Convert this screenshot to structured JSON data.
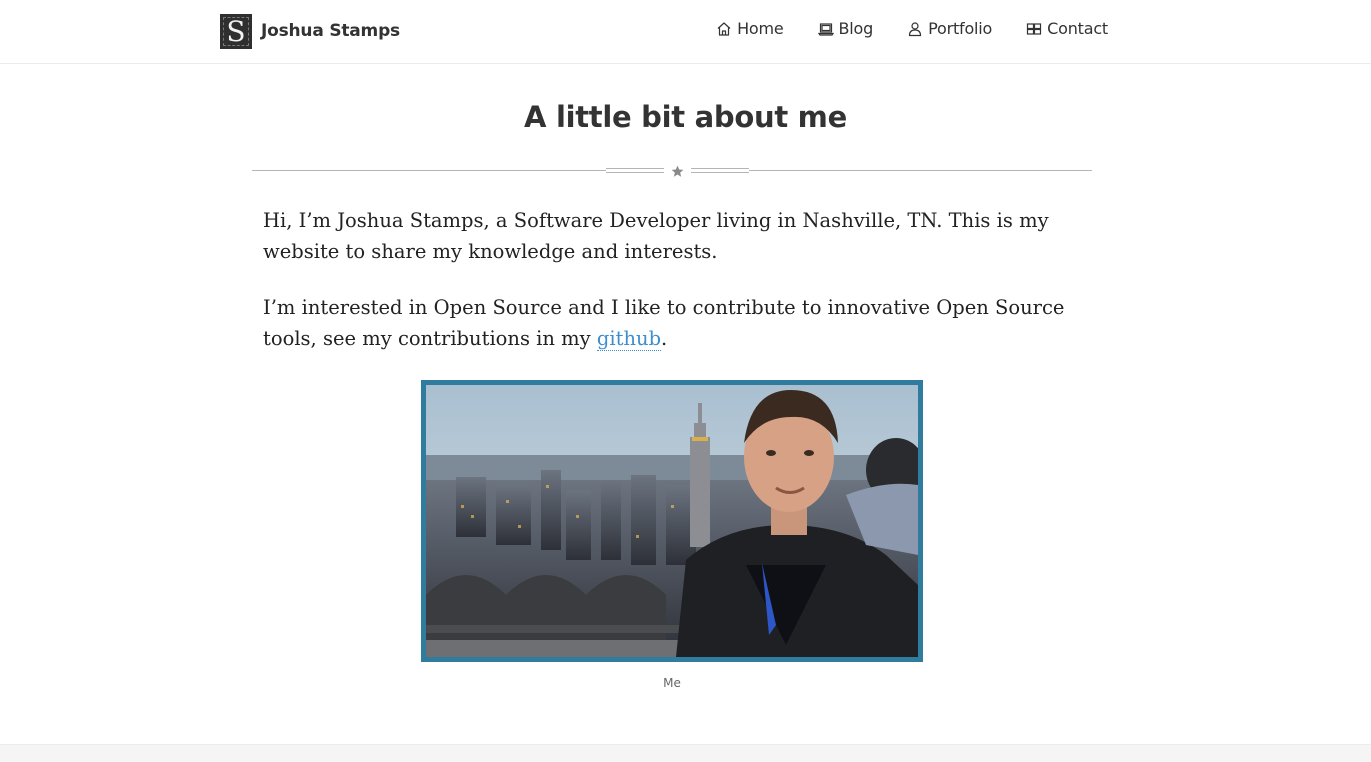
{
  "site": {
    "logo_letter": "S",
    "name": "Joshua Stamps"
  },
  "nav": {
    "home": "Home",
    "blog": "Blog",
    "portfolio": "Portfolio",
    "contact": "Contact"
  },
  "page": {
    "title": "A little bit about me",
    "paragraph1": "Hi, I’m Joshua Stamps, a Software Developer living in Nashville, TN. This is my website to share my knowledge and interests.",
    "paragraph2_before_link": "I’m interested in Open Source and I like to contribute to innovative Open Source tools, see my contributions in my ",
    "paragraph2_link": "github",
    "paragraph2_after_link": ".",
    "photo_caption": "Me"
  },
  "colors": {
    "accent_link": "#3d8ed0",
    "photo_border": "#2f7c9e",
    "text": "#333333"
  },
  "icons": {
    "home": "home-icon",
    "blog": "laptop-icon",
    "portfolio": "user-icon",
    "contact": "grid-icon",
    "divider": "star-icon"
  }
}
